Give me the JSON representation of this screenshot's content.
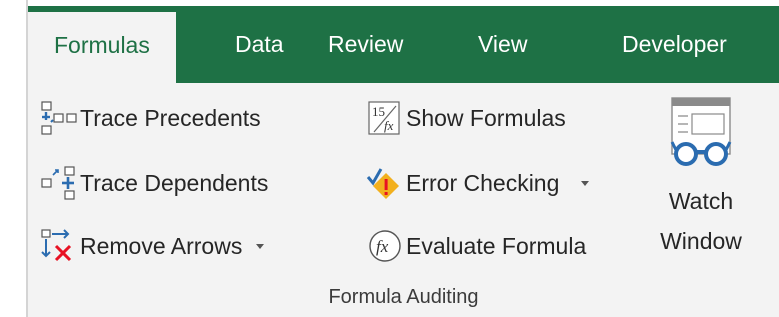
{
  "tabs": [
    {
      "label": "Formulas",
      "active": true
    },
    {
      "label": "Data"
    },
    {
      "label": "Review"
    },
    {
      "label": "View"
    },
    {
      "label": "Developer"
    }
  ],
  "colors": {
    "accent": "#1e7145",
    "ribbon_bg": "#f3f3f3",
    "icon_blue": "#2b6cb0",
    "icon_red": "#e81123",
    "icon_yellow": "#f2b01e"
  },
  "commands": {
    "trace_precedents": {
      "label": "Trace Precedents",
      "icon": "trace-precedents-icon"
    },
    "trace_dependents": {
      "label": "Trace Dependents",
      "icon": "trace-dependents-icon"
    },
    "remove_arrows": {
      "label": "Remove Arrows",
      "icon": "remove-arrows-icon",
      "has_dropdown": true
    },
    "show_formulas": {
      "label": "Show Formulas",
      "icon": "show-formulas-icon"
    },
    "error_checking": {
      "label": "Error Checking",
      "icon": "error-checking-icon",
      "has_dropdown": true
    },
    "evaluate_formula": {
      "label": "Evaluate Formula",
      "icon": "evaluate-formula-icon"
    },
    "watch_window": {
      "line1": "Watch",
      "line2": "Window",
      "icon": "watch-window-icon"
    }
  },
  "group": {
    "label": "Formula Auditing"
  }
}
